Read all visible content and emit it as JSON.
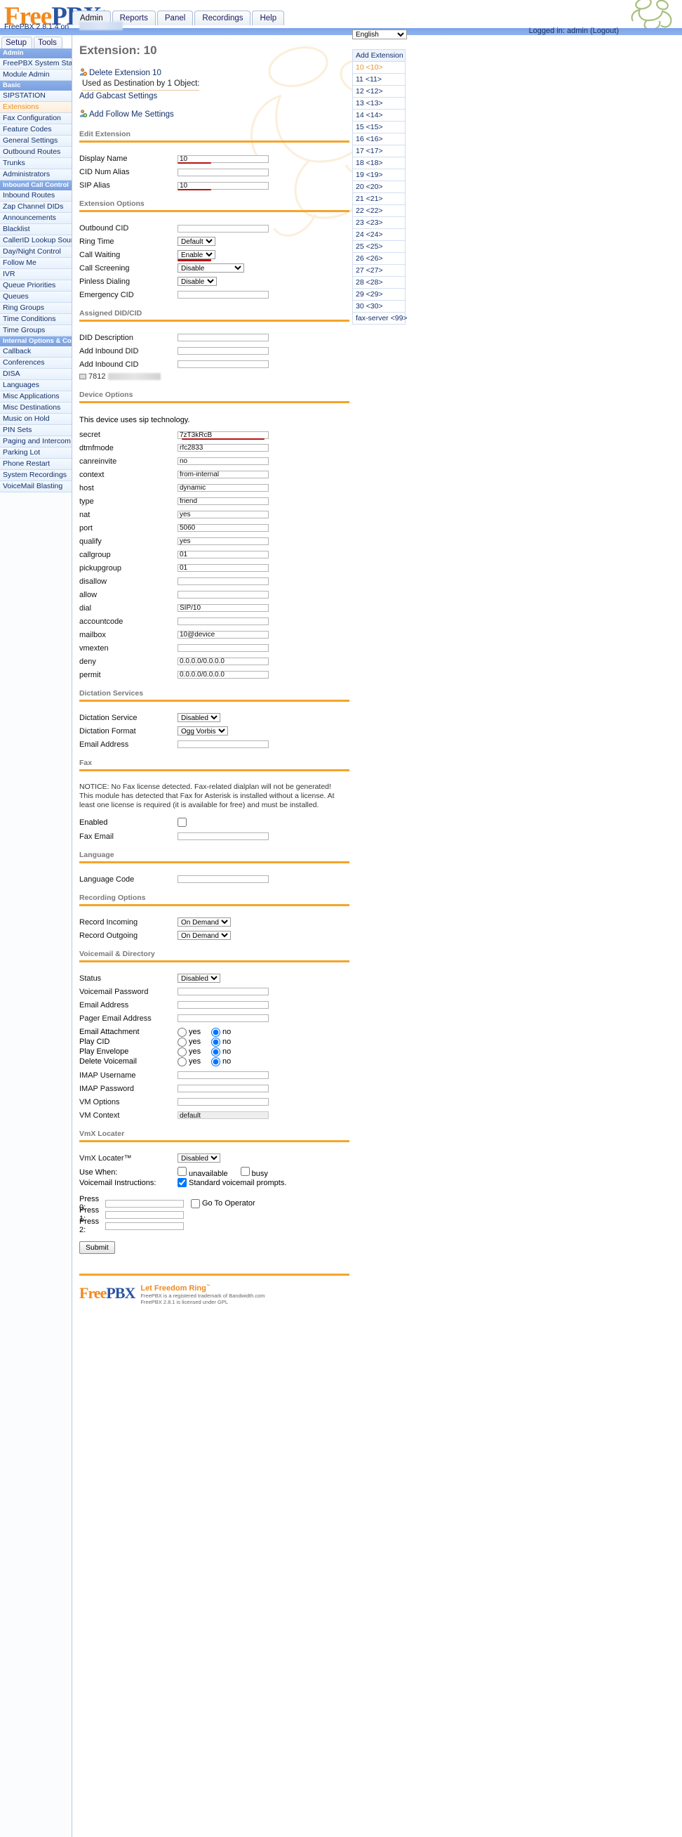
{
  "brand": {
    "logo_free": "Free",
    "logo_pbx": "PBX",
    "registered_mark": "®",
    "version_line": "FreePBX 2.8.1.4 on",
    "logged_in": "Logged in: admin (Logout)"
  },
  "nav": {
    "tabs": [
      {
        "label": "Admin",
        "active": true
      },
      {
        "label": "Reports",
        "active": false
      },
      {
        "label": "Panel",
        "active": false
      },
      {
        "label": "Recordings",
        "active": false
      },
      {
        "label": "Help",
        "active": false
      }
    ],
    "subtabs": [
      {
        "label": "Setup",
        "active": true
      },
      {
        "label": "Tools",
        "active": false
      }
    ]
  },
  "sidebar": {
    "groups": [
      {
        "header": "Admin",
        "items": [
          {
            "label": "FreePBX System Status",
            "selected": false
          },
          {
            "label": "Module Admin",
            "selected": false
          }
        ]
      },
      {
        "header": "Basic",
        "items": [
          {
            "label": "SIPSTATION",
            "selected": false
          },
          {
            "label": "Extensions",
            "selected": true
          },
          {
            "label": "Fax Configuration",
            "selected": false
          },
          {
            "label": "Feature Codes",
            "selected": false
          },
          {
            "label": "General Settings",
            "selected": false
          },
          {
            "label": "Outbound Routes",
            "selected": false
          },
          {
            "label": "Trunks",
            "selected": false
          },
          {
            "label": "Administrators",
            "selected": false
          }
        ]
      },
      {
        "header": "Inbound Call Control",
        "items": [
          {
            "label": "Inbound Routes",
            "selected": false
          },
          {
            "label": "Zap Channel DIDs",
            "selected": false
          },
          {
            "label": "Announcements",
            "selected": false
          },
          {
            "label": "Blacklist",
            "selected": false
          },
          {
            "label": "CallerID Lookup Sources",
            "selected": false
          },
          {
            "label": "Day/Night Control",
            "selected": false
          },
          {
            "label": "Follow Me",
            "selected": false
          },
          {
            "label": "IVR",
            "selected": false
          },
          {
            "label": "Queue Priorities",
            "selected": false
          },
          {
            "label": "Queues",
            "selected": false
          },
          {
            "label": "Ring Groups",
            "selected": false
          },
          {
            "label": "Time Conditions",
            "selected": false
          },
          {
            "label": "Time Groups",
            "selected": false
          }
        ]
      },
      {
        "header": "Internal Options & Configuration",
        "items": [
          {
            "label": "Callback",
            "selected": false
          },
          {
            "label": "Conferences",
            "selected": false
          },
          {
            "label": "DISA",
            "selected": false
          },
          {
            "label": "Languages",
            "selected": false
          },
          {
            "label": "Misc Applications",
            "selected": false
          },
          {
            "label": "Misc Destinations",
            "selected": false
          },
          {
            "label": "Music on Hold",
            "selected": false
          },
          {
            "label": "PIN Sets",
            "selected": false
          },
          {
            "label": "Paging and Intercom",
            "selected": false
          },
          {
            "label": "Parking Lot",
            "selected": false
          },
          {
            "label": "Phone Restart",
            "selected": false
          },
          {
            "label": "System Recordings",
            "selected": false
          },
          {
            "label": "VoiceMail Blasting",
            "selected": false
          }
        ]
      }
    ]
  },
  "page": {
    "title": "Extension: 10",
    "delete_link": "Delete Extension 10",
    "used_as_destination": "Used as Destination by 1 Object:",
    "add_gabcast": "Add Gabcast Settings",
    "add_follow_me": "Add Follow Me Settings"
  },
  "sections": {
    "edit_extension": {
      "title": "Edit Extension",
      "fields": [
        {
          "label": "Display Name",
          "value": "10",
          "marked": true
        },
        {
          "label": "CID Num Alias",
          "value": "",
          "marked": false
        },
        {
          "label": "SIP Alias",
          "value": "10",
          "marked": true
        }
      ]
    },
    "extension_options": {
      "title": "Extension Options",
      "outbound_cid_label": "Outbound CID",
      "outbound_cid_value": "",
      "ring_time_label": "Ring Time",
      "ring_time_value": "Default",
      "call_waiting_label": "Call Waiting",
      "call_waiting_value": "Enable",
      "call_screening_label": "Call Screening",
      "call_screening_value": "Disable",
      "pinless_dialing_label": "Pinless Dialing",
      "pinless_dialing_value": "Disable",
      "emergency_cid_label": "Emergency CID",
      "emergency_cid_value": ""
    },
    "assigned_did": {
      "title": "Assigned DID/CID",
      "did_description_label": "DID Description",
      "did_description_value": "",
      "add_inbound_did_label": "Add Inbound DID",
      "add_inbound_did_value": "",
      "add_inbound_cid_label": "Add Inbound CID",
      "add_inbound_cid_value": "",
      "did_entry": "7812"
    },
    "device_options": {
      "title": "Device Options",
      "note": "This device uses sip technology.",
      "fields": [
        {
          "label": "secret",
          "value": "7zT3kRcB",
          "marked": true
        },
        {
          "label": "dtmfmode",
          "value": "rfc2833",
          "marked": false
        },
        {
          "label": "canreinvite",
          "value": "no",
          "marked": false
        },
        {
          "label": "context",
          "value": "from-internal",
          "marked": false
        },
        {
          "label": "host",
          "value": "dynamic",
          "marked": false
        },
        {
          "label": "type",
          "value": "friend",
          "marked": false
        },
        {
          "label": "nat",
          "value": "yes",
          "marked": false
        },
        {
          "label": "port",
          "value": "5060",
          "marked": false
        },
        {
          "label": "qualify",
          "value": "yes",
          "marked": false
        },
        {
          "label": "callgroup",
          "value": "01",
          "marked": false
        },
        {
          "label": "pickupgroup",
          "value": "01",
          "marked": false
        },
        {
          "label": "disallow",
          "value": "",
          "marked": false
        },
        {
          "label": "allow",
          "value": "",
          "marked": false
        },
        {
          "label": "dial",
          "value": "SIP/10",
          "marked": false
        },
        {
          "label": "accountcode",
          "value": "",
          "marked": false
        },
        {
          "label": "mailbox",
          "value": "10@device",
          "marked": false
        },
        {
          "label": "vmexten",
          "value": "",
          "marked": false
        },
        {
          "label": "deny",
          "value": "0.0.0.0/0.0.0.0",
          "marked": false
        },
        {
          "label": "permit",
          "value": "0.0.0.0/0.0.0.0",
          "marked": false
        }
      ]
    },
    "dictation": {
      "title": "Dictation Services",
      "service_label": "Dictation Service",
      "service_value": "Disabled",
      "format_label": "Dictation Format",
      "format_value": "Ogg Vorbis",
      "email_label": "Email Address",
      "email_value": ""
    },
    "fax": {
      "title": "Fax",
      "notice": "NOTICE: No Fax license detected. Fax-related dialplan will not be generated! This module has detected that Fax for Asterisk is installed without a license. At least one license is required (it is available for free) and must be installed.",
      "enabled_label": "Enabled",
      "enabled_checked": false,
      "fax_email_label": "Fax Email",
      "fax_email_value": ""
    },
    "language": {
      "title": "Language",
      "code_label": "Language Code",
      "code_value": ""
    },
    "recording": {
      "title": "Recording Options",
      "record_incoming_label": "Record Incoming",
      "record_incoming_value": "On Demand",
      "record_outgoing_label": "Record Outgoing",
      "record_outgoing_value": "On Demand"
    },
    "voicemail": {
      "title": "Voicemail & Directory",
      "status_label": "Status",
      "status_value": "Disabled",
      "password_label": "Voicemail Password",
      "password_value": "",
      "email_label": "Email Address",
      "email_value": "",
      "pager_label": "Pager Email Address",
      "pager_value": "",
      "radios": [
        {
          "label": "Email Attachment",
          "yes": "yes",
          "no": "no",
          "selected": "no"
        },
        {
          "label": "Play CID",
          "yes": "yes",
          "no": "no",
          "selected": "no"
        },
        {
          "label": "Play Envelope",
          "yes": "yes",
          "no": "no",
          "selected": "no"
        },
        {
          "label": "Delete Voicemail",
          "yes": "yes",
          "no": "no",
          "selected": "no"
        }
      ],
      "imap_user_label": "IMAP Username",
      "imap_user_value": "",
      "imap_pass_label": "IMAP Password",
      "imap_pass_value": "",
      "vm_options_label": "VM Options",
      "vm_options_value": "",
      "vm_context_label": "VM Context",
      "vm_context_value": "default"
    },
    "vmx": {
      "title": "VmX Locater",
      "locater_label": "VmX Locater™",
      "locater_value": "Disabled",
      "use_when_label": "Use When:",
      "unavailable_label": "unavailable",
      "unavailable_checked": false,
      "busy_label": "busy",
      "busy_checked": false,
      "instructions_label": "Voicemail Instructions:",
      "standard_prompts_label": "Standard voicemail prompts.",
      "standard_prompts_checked": true,
      "press0_label": "Press 0:",
      "press0_value": "",
      "goto_operator_label": "Go To Operator",
      "goto_operator_checked": false,
      "press1_label": "Press 1:",
      "press1_value": "",
      "press2_label": "Press 2:",
      "press2_value": ""
    },
    "submit_label": "Submit"
  },
  "right": {
    "language_selected": "English",
    "add_extension": "Add Extension",
    "extensions": [
      {
        "label": "10 <10>",
        "selected": true
      },
      {
        "label": "11 <11>",
        "selected": false
      },
      {
        "label": "12 <12>",
        "selected": false
      },
      {
        "label": "13 <13>",
        "selected": false
      },
      {
        "label": "14 <14>",
        "selected": false
      },
      {
        "label": "15 <15>",
        "selected": false
      },
      {
        "label": "16 <16>",
        "selected": false
      },
      {
        "label": "17 <17>",
        "selected": false
      },
      {
        "label": "18 <18>",
        "selected": false
      },
      {
        "label": "19 <19>",
        "selected": false
      },
      {
        "label": "20 <20>",
        "selected": false
      },
      {
        "label": "21 <21>",
        "selected": false
      },
      {
        "label": "22 <22>",
        "selected": false
      },
      {
        "label": "23 <23>",
        "selected": false
      },
      {
        "label": "24 <24>",
        "selected": false
      },
      {
        "label": "25 <25>",
        "selected": false
      },
      {
        "label": "26 <26>",
        "selected": false
      },
      {
        "label": "27 <27>",
        "selected": false
      },
      {
        "label": "28 <28>",
        "selected": false
      },
      {
        "label": "29 <29>",
        "selected": false
      },
      {
        "label": "30 <30>",
        "selected": false
      },
      {
        "label": "fax-server <99>",
        "selected": false
      }
    ]
  },
  "footer": {
    "logo_free": "Free",
    "logo_pbx": "PBX",
    "slogan": "Let Freedom Ring",
    "slogan_tm": "™",
    "line1": "FreePBX is a registered trademark of Bandwidth.com",
    "line2": "FreePBX 2.8.1 is licensed under GPL"
  },
  "colors": {
    "accent_orange": "#F5A42A",
    "link_blue": "#12306b",
    "selected_orange": "#E8912B",
    "red_marker": "#BB1212"
  }
}
